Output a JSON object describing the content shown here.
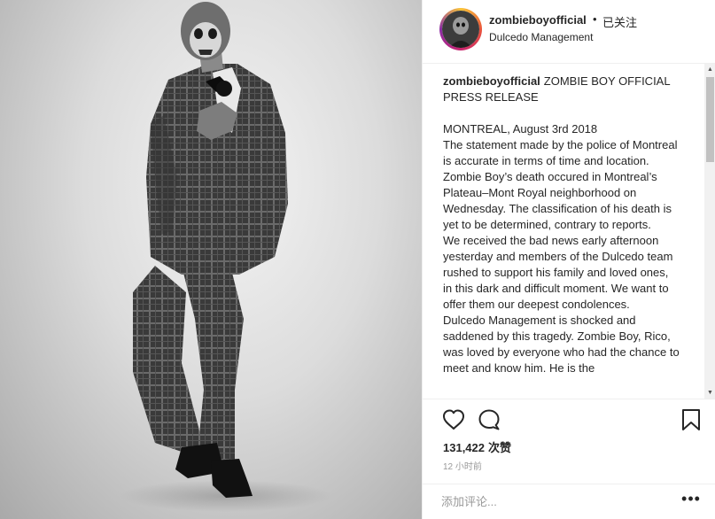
{
  "post": {
    "photo_alt": "",
    "header": {
      "username": "zombieboyofficial",
      "separator": "•",
      "follow_status": "已关注",
      "location": "Dulcedo Management"
    },
    "caption": {
      "author": "zombieboyofficial",
      "title_text": "ZOMBIE BOY OFFICIAL PRESS RELEASE",
      "body": "MONTREAL, August 3rd 2018\nThe statement made by the police of Montreal is accurate in terms of time and location. Zombie Boy’s death occured in Montreal’s Plateau–Mont Royal neighborhood on Wednesday. The classification of his death is yet to be determined, contrary to reports.\nWe received the bad news early afternoon yesterday and members of the Dulcedo team rushed to support his family and loved ones, in this dark and difficult moment. We want to offer them our deepest condolences.\nDulcedo Management is shocked and saddened by this tragedy. Zombie Boy, Rico, was loved by everyone who had the chance to meet and know him. He is the"
    },
    "actions": {
      "like_icon": "heart-outline-icon",
      "comment_icon": "comment-bubble-icon",
      "save_icon": "bookmark-icon"
    },
    "likes": {
      "count": "131,422",
      "unit": "次赞"
    },
    "timestamp": "12 小时前",
    "comment": {
      "placeholder": "添加评论...",
      "more_label": "•••"
    },
    "colors": {
      "text": "#262626",
      "muted": "#999999",
      "border": "#efefef",
      "ring_start": "#f9c437",
      "ring_end": "#8b2ea6"
    }
  }
}
